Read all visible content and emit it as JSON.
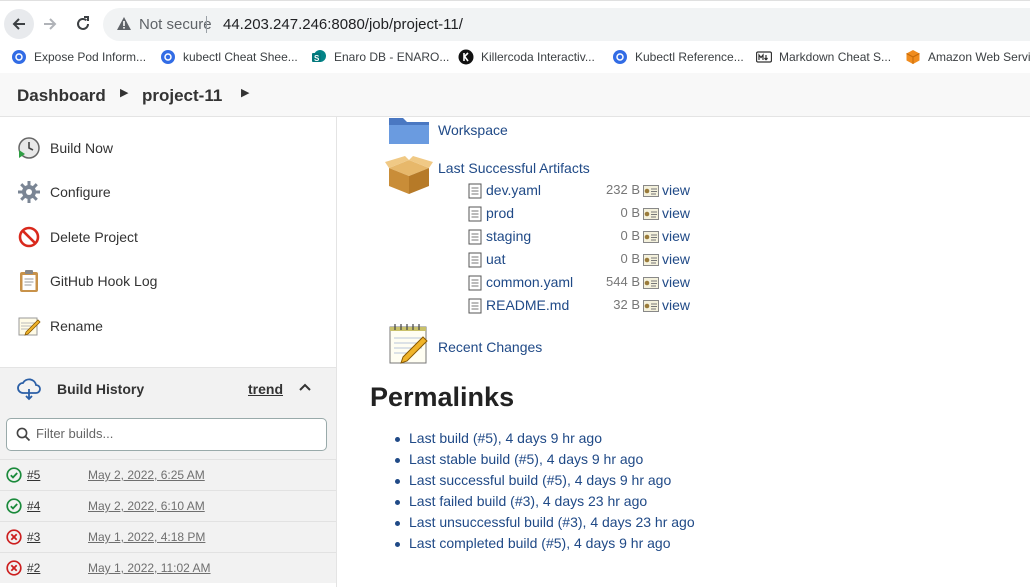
{
  "browser": {
    "security_label": "Not secure",
    "url": "44.203.247.246:8080/job/project-11/"
  },
  "bookmarks": [
    {
      "label": "Expose Pod Inform...",
      "icon": "kubernetes-icon"
    },
    {
      "label": "kubectl Cheat Shee...",
      "icon": "kubernetes-icon"
    },
    {
      "label": "Enaro DB - ENARO...",
      "icon": "sharepoint-icon"
    },
    {
      "label": "Killercoda Interactiv...",
      "icon": "killercoda-icon"
    },
    {
      "label": "Kubectl Reference...",
      "icon": "kubernetes-icon"
    },
    {
      "label": "Markdown Cheat S...",
      "icon": "markdown-icon"
    },
    {
      "label": "Amazon Web Servic",
      "icon": "aws-icon"
    }
  ],
  "breadcrumb": {
    "dashboard": "Dashboard",
    "project": "project-11"
  },
  "tasks": [
    {
      "label": "Build Now",
      "icon": "clock-play-icon"
    },
    {
      "label": "Configure",
      "icon": "gear-icon"
    },
    {
      "label": "Delete Project",
      "icon": "no-entry-icon"
    },
    {
      "label": "GitHub Hook Log",
      "icon": "clipboard-icon"
    },
    {
      "label": "Rename",
      "icon": "notepad-pencil-icon"
    }
  ],
  "build_history": {
    "title": "Build History",
    "trend": "trend",
    "filter_placeholder": "Filter builds...",
    "builds": [
      {
        "number": "#5",
        "date": "May 2, 2022, 6:25 AM",
        "status": "success"
      },
      {
        "number": "#4",
        "date": "May 2, 2022, 6:10 AM",
        "status": "success"
      },
      {
        "number": "#3",
        "date": "May 1, 2022, 4:18 PM",
        "status": "failed"
      },
      {
        "number": "#2",
        "date": "May 1, 2022, 11:02 AM",
        "status": "failed"
      }
    ]
  },
  "main": {
    "workspace": "Workspace",
    "last_successful_artifacts": "Last Successful Artifacts",
    "artifacts": [
      {
        "name": "dev.yaml",
        "size": "232 B",
        "view": "view"
      },
      {
        "name": "prod",
        "size": "0 B",
        "view": "view"
      },
      {
        "name": "staging",
        "size": "0 B",
        "view": "view"
      },
      {
        "name": "uat",
        "size": "0 B",
        "view": "view"
      },
      {
        "name": "common.yaml",
        "size": "544 B",
        "view": "view"
      },
      {
        "name": "README.md",
        "size": "32 B",
        "view": "view"
      }
    ],
    "recent_changes": "Recent Changes",
    "permalinks_title": "Permalinks",
    "permalinks": [
      "Last build (#5), 4 days 9 hr ago",
      "Last stable build (#5), 4 days 9 hr ago",
      "Last successful build (#5), 4 days 9 hr ago",
      "Last failed build (#3), 4 days 23 hr ago",
      "Last unsuccessful build (#3), 4 days 23 hr ago",
      "Last completed build (#5), 4 days 9 hr ago"
    ]
  },
  "colors": {
    "link": "#204a87",
    "success": "#1a8a3b",
    "failed": "#cc1f1f"
  }
}
